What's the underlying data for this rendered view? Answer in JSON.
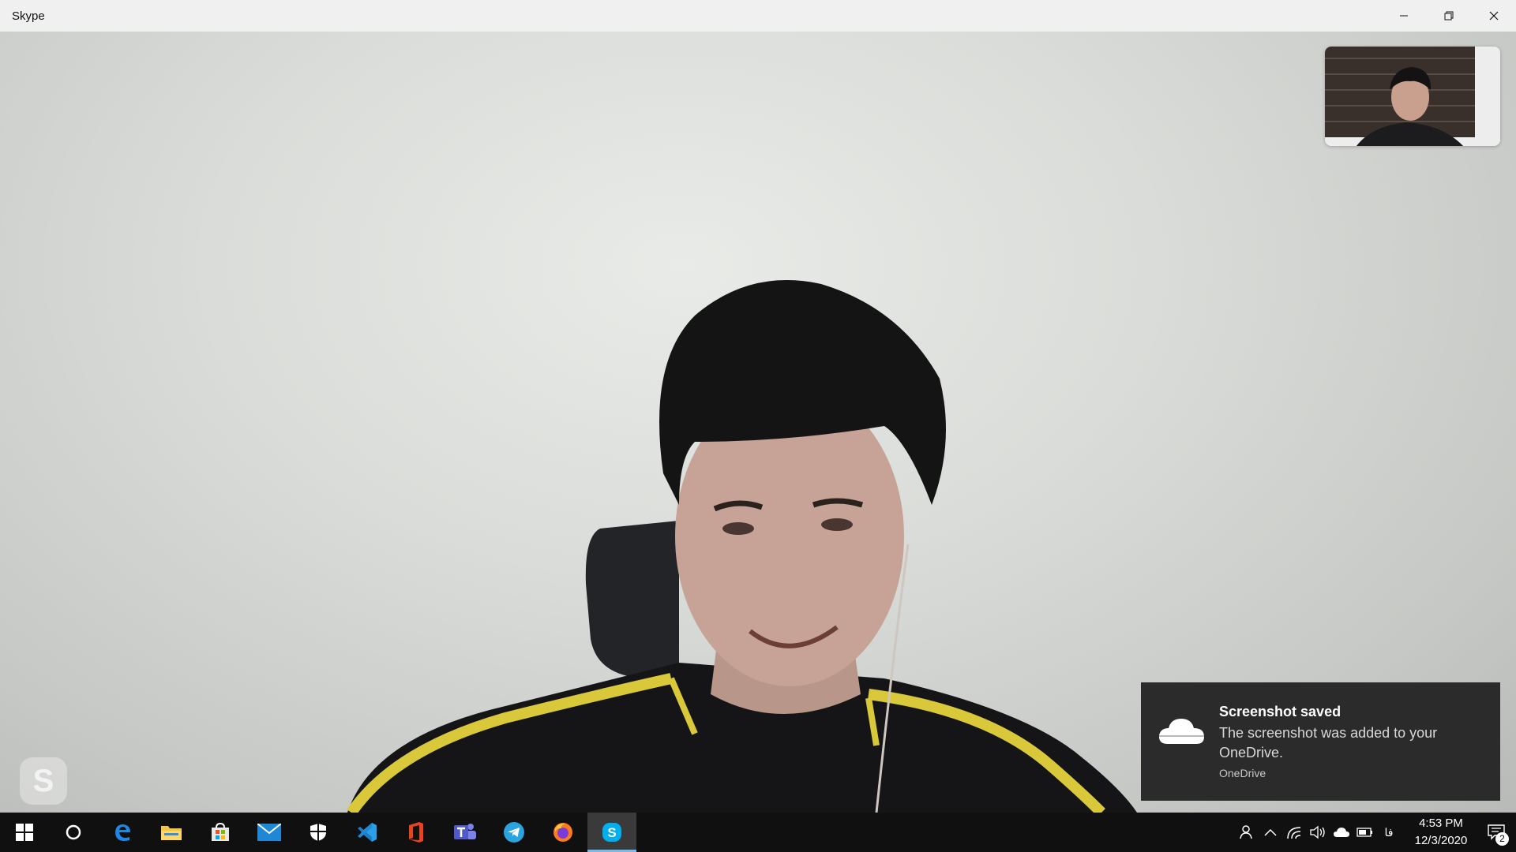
{
  "window": {
    "title": "Skype",
    "controls": [
      "minimize-icon",
      "restore-icon",
      "close-icon"
    ]
  },
  "call": {
    "watermark_letter": "S"
  },
  "toast": {
    "title": "Screenshot saved",
    "body": "The screenshot was added to your OneDrive.",
    "app": "OneDrive",
    "icon": "cloud-icon"
  },
  "taskbar": {
    "apps": [
      {
        "name": "start-button",
        "icon": "windows-logo-icon"
      },
      {
        "name": "search-button",
        "icon": "cortana-circle-icon"
      },
      {
        "name": "edge",
        "icon": "edge-icon"
      },
      {
        "name": "file-explorer",
        "icon": "folder-icon"
      },
      {
        "name": "microsoft-store",
        "icon": "store-icon"
      },
      {
        "name": "mail",
        "icon": "mail-icon"
      },
      {
        "name": "windows-security",
        "icon": "shield-icon"
      },
      {
        "name": "vscode",
        "icon": "vscode-icon"
      },
      {
        "name": "office",
        "icon": "office-icon"
      },
      {
        "name": "teams",
        "icon": "teams-icon"
      },
      {
        "name": "telegram",
        "icon": "telegram-icon"
      },
      {
        "name": "firefox",
        "icon": "firefox-icon"
      },
      {
        "name": "skype",
        "icon": "skype-icon",
        "active": true
      }
    ],
    "tray": {
      "language": "فا",
      "time": "4:53 PM",
      "date": "12/3/2020",
      "notification_count": "2"
    }
  },
  "colors": {
    "taskbar_bg": "#101010",
    "active_indicator": "#76b9ed",
    "toast_bg": "#2b2b2b",
    "skype_blue": "#00aff0"
  }
}
